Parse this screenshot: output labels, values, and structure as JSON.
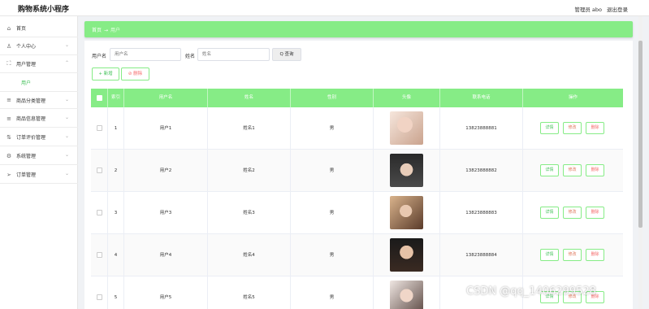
{
  "app_title": "购物系统小程序",
  "header": {
    "admin": "管理员 abo",
    "logout": "退出登录"
  },
  "sidebar": {
    "items": [
      {
        "label": "首页",
        "icon": "home-icon"
      },
      {
        "label": "个人中心",
        "icon": "user-icon"
      },
      {
        "label": "用户管理",
        "icon": "users-icon"
      },
      {
        "label": "商品分类管理",
        "icon": "list-icon"
      },
      {
        "label": "商品信息管理",
        "icon": "list-icon"
      },
      {
        "label": "订单评价管理",
        "icon": "comment-icon"
      },
      {
        "label": "系统管理",
        "icon": "gear-icon"
      },
      {
        "label": "订单管理",
        "icon": "send-icon"
      }
    ],
    "active_sub": "用户"
  },
  "breadcrumb": {
    "home": "首页",
    "separator": "→",
    "current": "用户"
  },
  "search": {
    "username_label": "用户名",
    "username_placeholder": "用户名",
    "name_label": "姓名",
    "name_placeholder": "姓名",
    "button": "Q 查询"
  },
  "actions": {
    "add": "+ 新增",
    "delete": "⊘ 删除"
  },
  "table": {
    "headers": [
      "索引",
      "用户名",
      "姓名",
      "性别",
      "头像",
      "联系电话",
      "操作"
    ],
    "rows": [
      {
        "index": "1",
        "username": "用户1",
        "name": "姓名1",
        "gender": "男",
        "phone": "13823888881"
      },
      {
        "index": "2",
        "username": "用户2",
        "name": "姓名2",
        "gender": "男",
        "phone": "13823888882"
      },
      {
        "index": "3",
        "username": "用户3",
        "name": "姓名3",
        "gender": "男",
        "phone": "13823888883"
      },
      {
        "index": "4",
        "username": "用户4",
        "name": "姓名4",
        "gender": "男",
        "phone": "13823888884"
      },
      {
        "index": "5",
        "username": "用户5",
        "name": "姓名5",
        "gender": "男",
        "phone": ""
      }
    ],
    "ops": {
      "detail": "详情",
      "edit": "修改",
      "delete": "删除"
    }
  },
  "watermark": "CSDN @qq_1406299528",
  "colors": {
    "accent": "#86ec86",
    "accent_text": "#40c057",
    "danger": "#f56c6c"
  }
}
